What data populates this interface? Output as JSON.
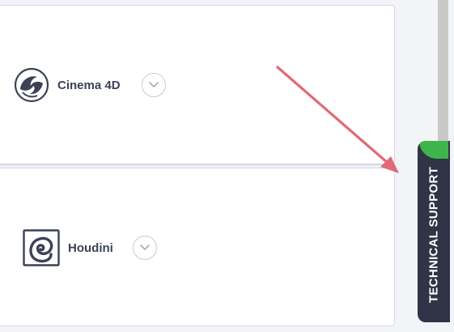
{
  "apps": [
    {
      "name": "Cinema 4D",
      "logo_icon": "cinema4d-logo-icon",
      "expand_icon": "chevron-down-icon"
    },
    {
      "name": "Houdini",
      "logo_icon": "houdini-logo-icon",
      "expand_icon": "chevron-down-icon"
    }
  ],
  "support_tab": {
    "label": "TECHNICAL SUPPORT",
    "accent_color": "#3db54a",
    "background_color": "#2f3547"
  },
  "annotation": {
    "arrow_color": "#e06a78",
    "arrow_icon": "annotation-arrow-icon"
  },
  "colors": {
    "text": "#3b4256",
    "card_border": "#d6d9e3",
    "page_background": "#f3f4f8"
  }
}
